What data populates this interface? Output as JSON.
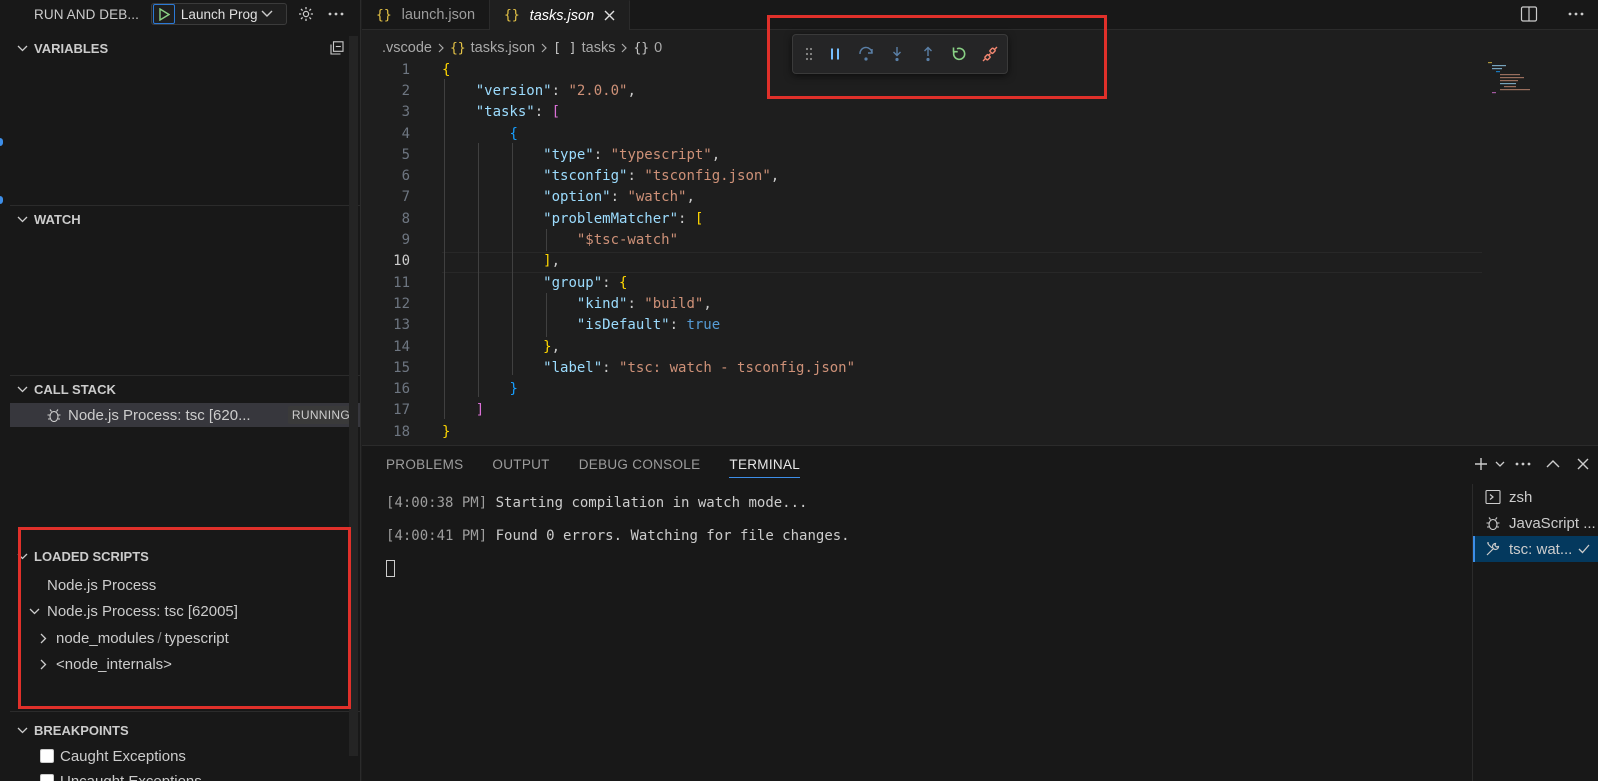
{
  "sidebar": {
    "title": "RUN AND DEB...",
    "launch_config": "Launch Prog",
    "sections": {
      "variables": "VARIABLES",
      "watch": "WATCH",
      "call_stack": "CALL STACK",
      "loaded_scripts": "LOADED SCRIPTS",
      "breakpoints": "BREAKPOINTS"
    },
    "call_stack_item": {
      "label": "Node.js Process: tsc [620...",
      "status": "RUNNING"
    },
    "loaded_scripts": [
      "Node.js Process",
      "Node.js Process: tsc [62005]",
      "node_modules",
      "typescript",
      "<node_internals>"
    ],
    "breakpoints": [
      "Caught Exceptions",
      "Uncaught Exceptions"
    ]
  },
  "tabs": [
    {
      "label": "launch.json",
      "icon": "{}"
    },
    {
      "label": "tasks.json",
      "icon": "{}"
    }
  ],
  "breadcrumb": [
    ".vscode",
    "tasks.json",
    "tasks",
    "0"
  ],
  "breadcrumb_icons": [
    "{}",
    "[ ]",
    "{}"
  ],
  "code_lines": [
    "1",
    "2",
    "3",
    "4",
    "5",
    "6",
    "7",
    "8",
    "9",
    "10",
    "11",
    "12",
    "13",
    "14",
    "15",
    "16",
    "17",
    "18"
  ],
  "code": {
    "version_key": "\"version\"",
    "version_val": "\"2.0.0\"",
    "tasks_key": "\"tasks\"",
    "type_key": "\"type\"",
    "type_val": "\"typescript\"",
    "tsconfig_key": "\"tsconfig\"",
    "tsconfig_val": "\"tsconfig.json\"",
    "option_key": "\"option\"",
    "option_val": "\"watch\"",
    "pm_key": "\"problemMatcher\"",
    "pm_val": "\"$tsc-watch\"",
    "group_key": "\"group\"",
    "kind_key": "\"kind\"",
    "kind_val": "\"build\"",
    "default_key": "\"isDefault\"",
    "default_val": "true",
    "label_key": "\"label\"",
    "label_val": "\"tsc: watch - tsconfig.json\""
  },
  "panel": {
    "tabs": [
      "PROBLEMS",
      "OUTPUT",
      "DEBUG CONSOLE",
      "TERMINAL"
    ],
    "terminal_lines": [
      {
        "time": "4:00:38 PM",
        "text": "Starting compilation in watch mode..."
      },
      {
        "time": "4:00:41 PM",
        "text": "Found 0 errors. Watching for file changes."
      }
    ],
    "terminals": [
      "zsh",
      "JavaScript ...",
      "tsc: wat..."
    ]
  }
}
